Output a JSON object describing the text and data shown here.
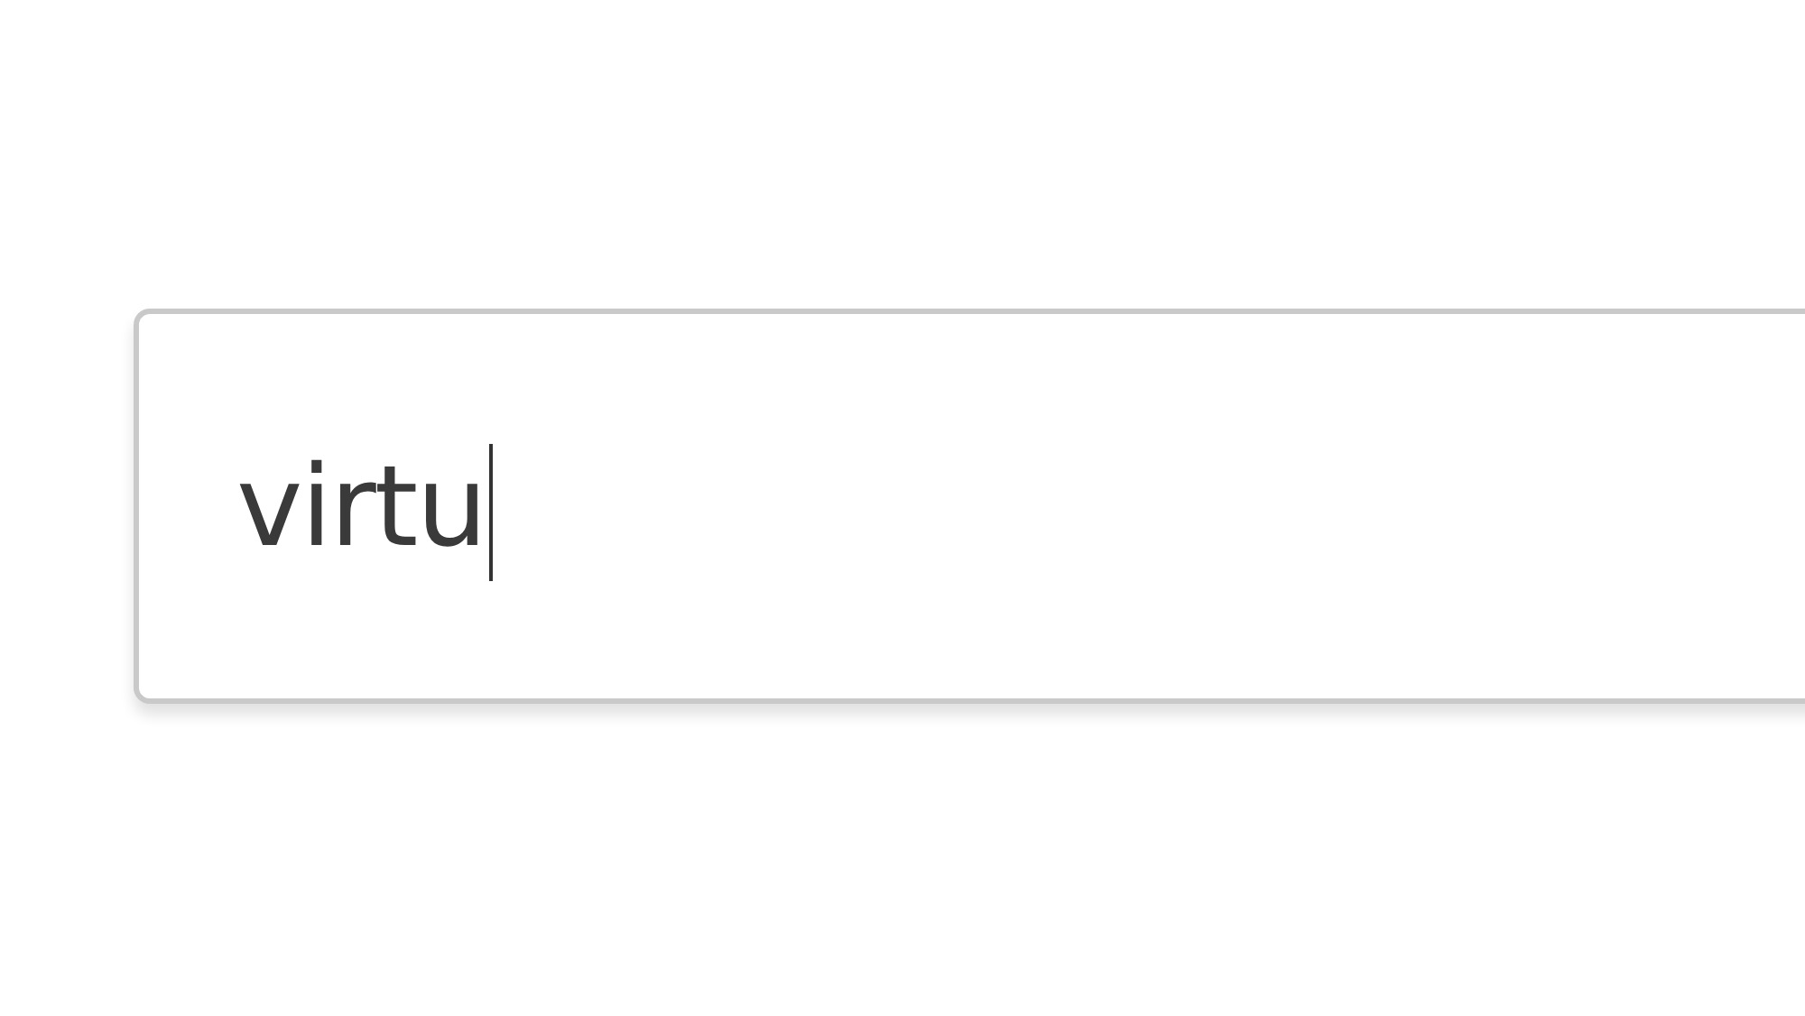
{
  "search_field": {
    "value": "virtu",
    "focused": true
  }
}
